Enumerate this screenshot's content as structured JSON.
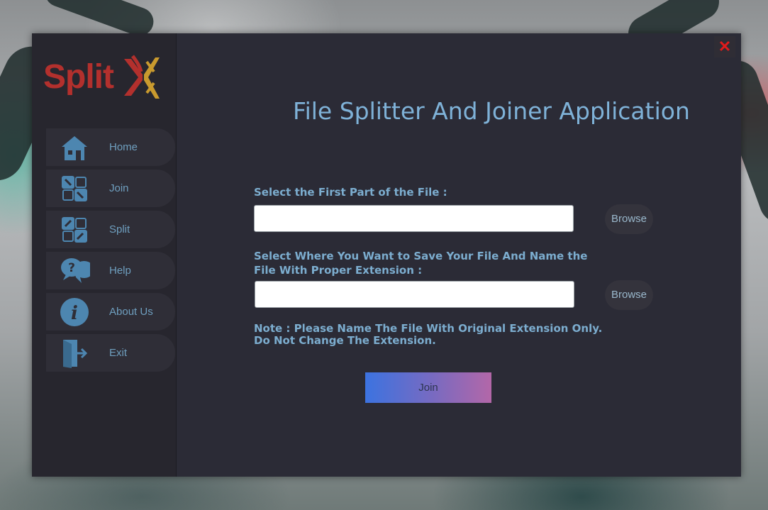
{
  "app": {
    "logo_text": "Split",
    "title": "File Splitter And Joiner Application"
  },
  "sidebar": {
    "items": [
      {
        "label": "Home",
        "icon": "home-icon"
      },
      {
        "label": "Join",
        "icon": "join-icon"
      },
      {
        "label": "Split",
        "icon": "split-icon"
      },
      {
        "label": "Help",
        "icon": "help-icon"
      },
      {
        "label": "About Us",
        "icon": "info-icon"
      },
      {
        "label": "Exit",
        "icon": "exit-icon"
      }
    ]
  },
  "window": {
    "close_label": "✕"
  },
  "form": {
    "first_part_label": "Select the First Part of the File :",
    "first_part_value": "",
    "save_label_line1": "Select Where You Want to Save Your File  And Name the",
    "save_label_line2": "File With Proper Extension :",
    "save_value": "",
    "browse_label": "Browse",
    "note_line1": "Note : Please Name The File With Original Extension Only.",
    "note_line2": "Do Not Change The Extension.",
    "submit_label": "Join"
  },
  "colors": {
    "accent": "#7cadcf",
    "logo_red": "#b3302d",
    "logo_gold": "#c99a2e",
    "close": "#e01b1b"
  }
}
